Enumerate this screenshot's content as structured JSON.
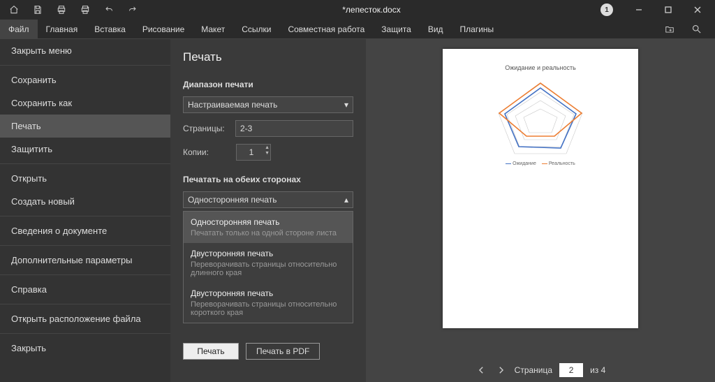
{
  "titlebar": {
    "title": "*лепесток.docx",
    "badge": "1"
  },
  "tabs": [
    "Файл",
    "Главная",
    "Вставка",
    "Рисование",
    "Макет",
    "Ссылки",
    "Совместная работа",
    "Защита",
    "Вид",
    "Плагины"
  ],
  "sidebar": {
    "items": [
      {
        "label": "Закрыть меню"
      },
      {
        "label": "Сохранить"
      },
      {
        "label": "Сохранить как"
      },
      {
        "label": "Печать",
        "selected": true
      },
      {
        "label": "Защитить"
      },
      {
        "label": "Открыть"
      },
      {
        "label": "Создать новый"
      },
      {
        "label": "Сведения о документе"
      },
      {
        "label": "Дополнительные параметры"
      },
      {
        "label": "Справка"
      },
      {
        "label": "Открыть расположение файла"
      },
      {
        "label": "Закрыть"
      }
    ]
  },
  "settings": {
    "title": "Печать",
    "range_label": "Диапазон печати",
    "range_value": "Настраиваемая печать",
    "pages_label": "Страницы:",
    "pages_value": "2-3",
    "copies_label": "Копии:",
    "copies_value": "1",
    "sides_label": "Печатать на обеих сторонах",
    "sides_value": "Односторонняя печать",
    "options": [
      {
        "title": "Односторонняя печать",
        "desc": "Печатать только на одной стороне листа",
        "hover": true
      },
      {
        "title": "Двусторонняя печать",
        "desc": "Переворачивать страницы относительно длинного края"
      },
      {
        "title": "Двусторонняя печать",
        "desc": "Переворачивать страницы относительно короткого края"
      }
    ],
    "print_btn": "Печать",
    "pdf_btn": "Печать в PDF"
  },
  "preview": {
    "page_label": "Страница",
    "current": "2",
    "of_label": "из",
    "total": "4",
    "doc_title": "Ожидание и реальность",
    "legend1": "Ожидание",
    "legend2": "Реальность"
  },
  "chart_data": {
    "type": "radar",
    "title": "Ожидание и реальность",
    "series": [
      {
        "name": "Ожидание",
        "color": "#4472C4",
        "values": [
          80,
          70,
          60,
          55,
          65
        ]
      },
      {
        "name": "Реальность",
        "color": "#ED7D31",
        "values": [
          95,
          90,
          40,
          45,
          85
        ]
      }
    ],
    "rlim": [
      0,
      100
    ]
  }
}
